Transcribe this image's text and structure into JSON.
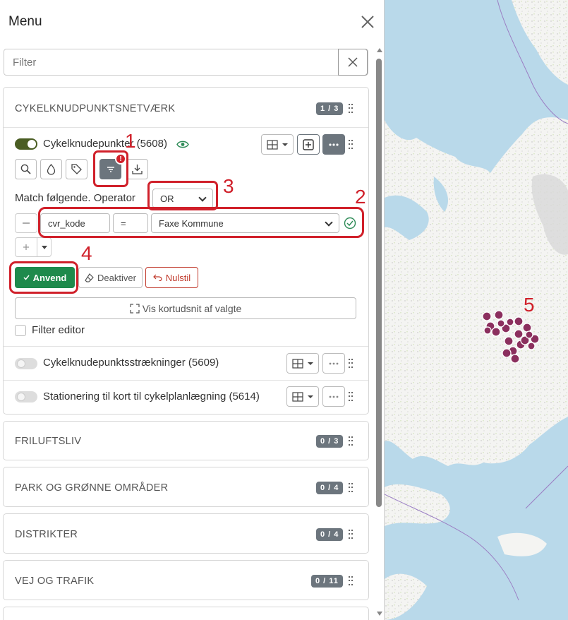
{
  "panel": {
    "title": "Menu",
    "filter_placeholder": "Filter"
  },
  "group1": {
    "title": "CYKELKNUDPUNKTSNETVÆRK",
    "badge": "1 / 3",
    "layers": [
      {
        "label": "Cykelknudepunkter (5608)",
        "enabled": true
      },
      {
        "label": "Cykelknudepunktsstrækninger (5609)",
        "enabled": false
      },
      {
        "label": "Stationering til kort til cykelplanlægning (5614)",
        "enabled": false
      }
    ]
  },
  "filter_editor": {
    "match_label": "Match følgende. Operator",
    "operator": "OR",
    "field": "cvr_kode",
    "comparison": "=",
    "value": "Faxe Kommune",
    "apply_label": "Anvend",
    "deactivate_label": "Deaktiver",
    "reset_label": "Nulstil",
    "zoom_label": "Vis kortudsnit af valgte",
    "editor_checkbox_label": "Filter editor"
  },
  "groups": [
    {
      "title": "FRILUFTSLIV",
      "badge": "0 / 3"
    },
    {
      "title": "PARK OG GRØNNE OMRÅDER",
      "badge": "0 / 4"
    },
    {
      "title": "DISTRIKTER",
      "badge": "0 / 4"
    },
    {
      "title": "VEJ OG TRAFIK",
      "badge": "0 / 11"
    }
  ],
  "annotations": [
    "1",
    "2",
    "3",
    "4",
    "5"
  ],
  "colors": {
    "accent_green": "#1e8a4c",
    "toggle_on": "#4a5d23",
    "annotation_red": "#d0202a",
    "map_point": "#8b2f5e",
    "sea": "#b9d9ea",
    "land": "#f4f4f2"
  }
}
